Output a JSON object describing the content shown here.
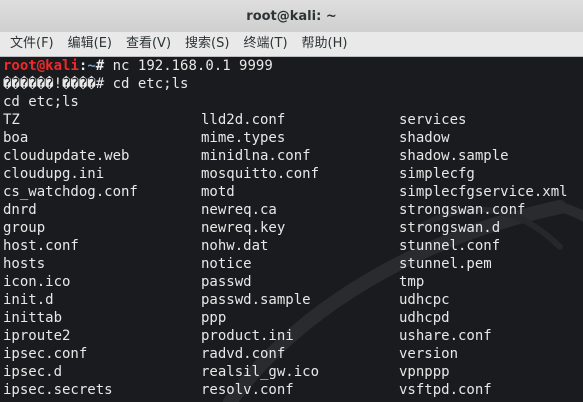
{
  "window": {
    "title": "root@kali: ~"
  },
  "menu": [
    "文件(F)",
    "编辑(E)",
    "查看(V)",
    "搜索(S)",
    "终端(T)",
    "帮助(H)"
  ],
  "terminal": {
    "prompt": {
      "user": "root",
      "at": "@",
      "host": "kali",
      "path": "~",
      "symbol": "#"
    },
    "command": " nc 192.168.0.1 9999",
    "remote_line": "������!����# cd etc;ls",
    "echo_line": "cd etc;ls",
    "listing": [
      [
        "TZ",
        "lld2d.conf",
        "services"
      ],
      [
        "boa",
        "mime.types",
        "shadow"
      ],
      [
        "cloudupdate.web",
        "minidlna.conf",
        "shadow.sample"
      ],
      [
        "cloudupg.ini",
        "mosquitto.conf",
        "simplecfg"
      ],
      [
        "cs_watchdog.conf",
        "motd",
        "simplecfgservice.xml"
      ],
      [
        "dnrd",
        "newreq.ca",
        "strongswan.conf"
      ],
      [
        "group",
        "newreq.key",
        "strongswan.d"
      ],
      [
        "host.conf",
        "nohw.dat",
        "stunnel.conf"
      ],
      [
        "hosts",
        "notice",
        "stunnel.pem"
      ],
      [
        "icon.ico",
        "passwd",
        "tmp"
      ],
      [
        "init.d",
        "passwd.sample",
        "udhcpc"
      ],
      [
        "inittab",
        "ppp",
        "udhcpd"
      ],
      [
        "iproute2",
        "product.ini",
        "ushare.conf"
      ],
      [
        "ipsec.conf",
        "radvd.conf",
        "version"
      ],
      [
        "ipsec.d",
        "realsil_gw.ico",
        "vpnppp"
      ],
      [
        "ipsec.secrets",
        "resolv.conf",
        "vsftpd.conf"
      ]
    ]
  },
  "colors": {
    "background": "#1a1b1e",
    "prompt_red": "#ef2929",
    "prompt_blue": "#729fcf",
    "text": "#e8e8e8"
  }
}
